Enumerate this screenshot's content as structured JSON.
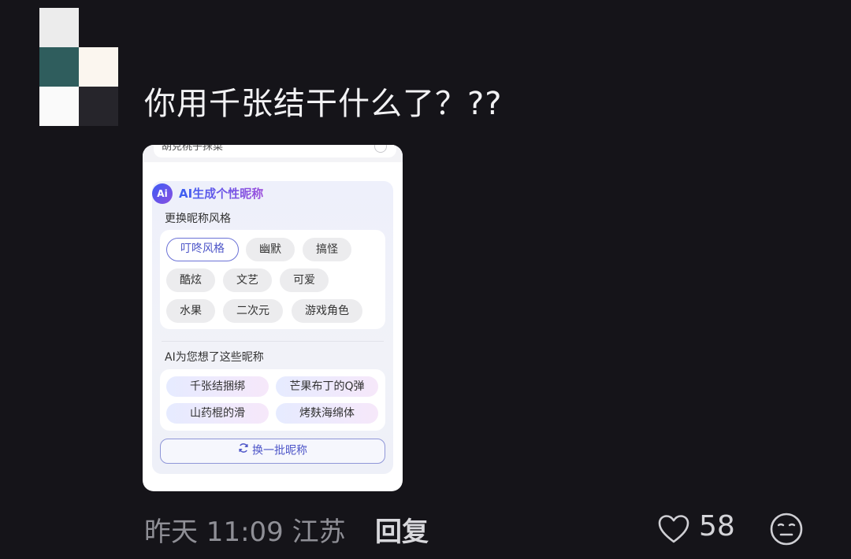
{
  "comment": {
    "text": "你用千张结干什么了？??",
    "attachment": {
      "prev_item_text": "胡克桃子抹菜",
      "ai_badge": "Ai",
      "panel_title": "AI生成个性昵称",
      "style_label": "更换昵称风格",
      "styles": [
        "叮咚风格",
        "幽默",
        "搞怪",
        "酷炫",
        "文艺",
        "可爱",
        "水果",
        "二次元",
        "游戏角色"
      ],
      "selected_style": "叮咚风格",
      "suggest_label": "AI为您想了这些昵称",
      "suggestions": [
        "千张结捆绑",
        "芒果布丁的Q弹",
        "山药棍的滑",
        "烤麸海绵体"
      ],
      "refresh_label": "换一批昵称"
    },
    "time": "昨天 11:09",
    "location": "江苏",
    "reply_label": "回复",
    "like_count": "58"
  },
  "icons": {
    "like": "heart-outline-icon",
    "emoji": "neutral-face-icon",
    "refresh": "refresh-icon"
  },
  "colors": {
    "background": "#151419",
    "accent": "#4d55c8"
  }
}
